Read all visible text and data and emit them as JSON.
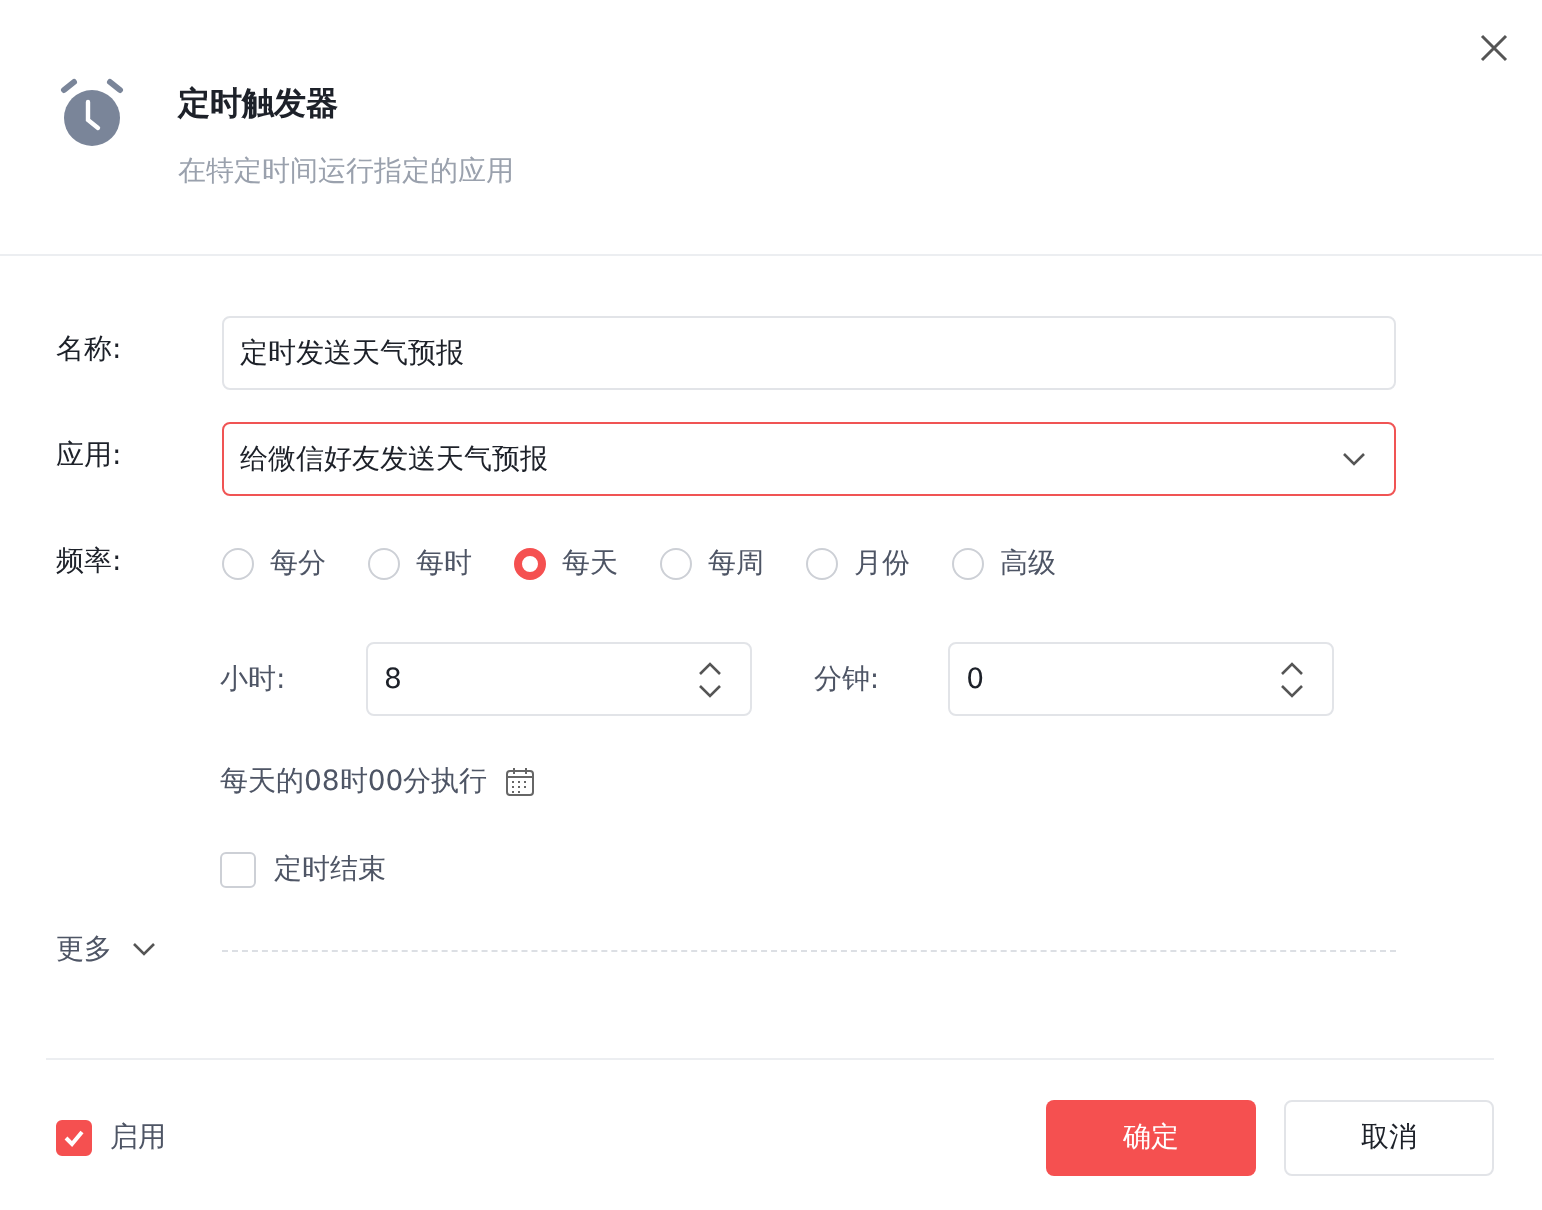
{
  "dialog": {
    "title": "定时触发器",
    "subtitle": "在特定时间运行指定的应用"
  },
  "form": {
    "name": {
      "label": "名称:",
      "value": "定时发送天气预报"
    },
    "app": {
      "label": "应用:",
      "value": "给微信好友发送天气预报",
      "focused": true
    },
    "frequency": {
      "label": "频率:",
      "options": [
        {
          "label": "每分",
          "selected": false
        },
        {
          "label": "每时",
          "selected": false
        },
        {
          "label": "每天",
          "selected": true
        },
        {
          "label": "每周",
          "selected": false
        },
        {
          "label": "月份",
          "selected": false
        },
        {
          "label": "高级",
          "selected": false
        }
      ]
    },
    "hour": {
      "label": "小时:",
      "value": "8"
    },
    "minute": {
      "label": "分钟:",
      "value": "0"
    },
    "summary": "每天的08时00分执行",
    "end_timer": {
      "label": "定时结束",
      "checked": false
    },
    "more": {
      "label": "更多",
      "expanded": false
    }
  },
  "footer": {
    "enable": {
      "label": "启用",
      "checked": true
    },
    "buttons": [
      {
        "label": "确定",
        "kind": "primary"
      },
      {
        "label": "取消",
        "kind": "secondary"
      }
    ]
  }
}
